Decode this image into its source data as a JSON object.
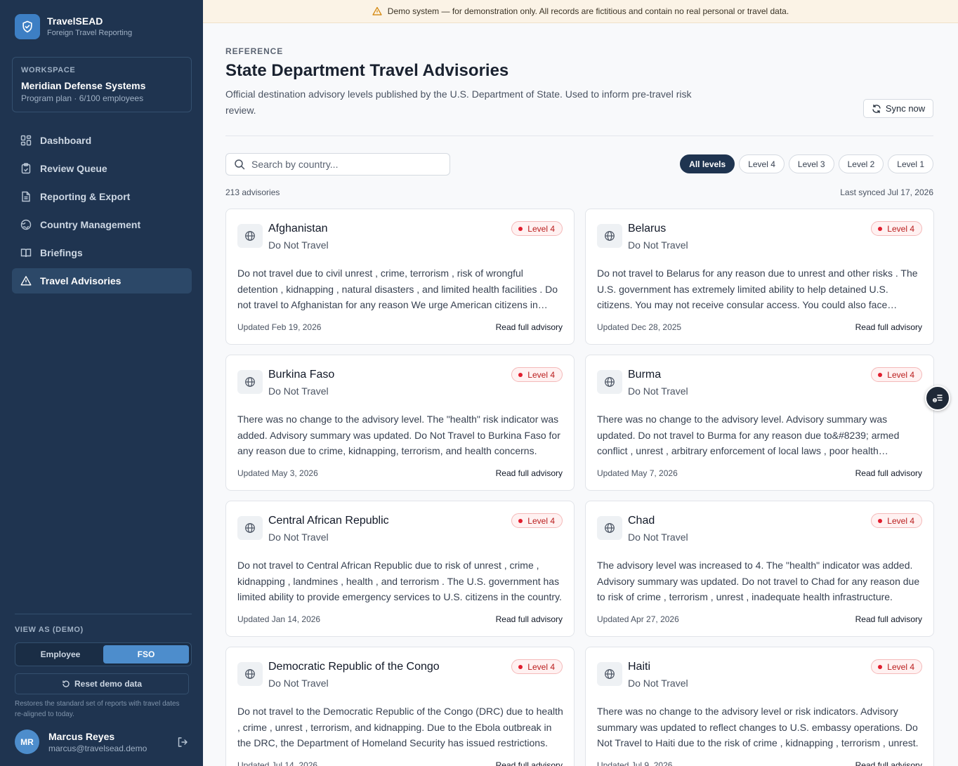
{
  "brand": {
    "name": "TravelSEAD",
    "subtitle": "Foreign Travel Reporting"
  },
  "workspace": {
    "label": "WORKSPACE",
    "name": "Meridian Defense Systems",
    "plan": "Program plan · 6/100 employees"
  },
  "nav": [
    {
      "label": "Dashboard",
      "icon": "dashboard-icon",
      "active": false
    },
    {
      "label": "Review Queue",
      "icon": "clipboard-icon",
      "active": false
    },
    {
      "label": "Reporting & Export",
      "icon": "document-icon",
      "active": false
    },
    {
      "label": "Country Management",
      "icon": "globe-icon",
      "active": false
    },
    {
      "label": "Briefings",
      "icon": "book-icon",
      "active": false
    },
    {
      "label": "Travel Advisories",
      "icon": "warning-icon",
      "active": true
    }
  ],
  "view_as": {
    "label": "VIEW AS (DEMO)",
    "options": [
      "Employee",
      "FSO"
    ],
    "selected": "FSO"
  },
  "reset": {
    "label": "Reset demo data",
    "note": "Restores the standard set of reports with travel dates re-aligned to today."
  },
  "user": {
    "initials": "MR",
    "name": "Marcus Reyes",
    "email": "marcus@travelsead.demo"
  },
  "banner": {
    "text": "Demo system — for demonstration only. All records are fictitious and contain no real personal or travel data."
  },
  "page": {
    "eyebrow": "REFERENCE",
    "title": "State Department Travel Advisories",
    "description": "Official destination advisory levels published by the U.S. Department of State. Used to inform pre-travel risk review.",
    "sync_label": "Sync now",
    "search_placeholder": "Search by country...",
    "filters": [
      "All levels",
      "Level 4",
      "Level 3",
      "Level 2",
      "Level 1"
    ],
    "active_filter": "All levels",
    "count": "213 advisories",
    "last_synced": "Last synced Jul 17, 2026"
  },
  "colors": {
    "sidebar": "#1f3450",
    "accent": "#4d8dcc",
    "level4": "#e11d2d"
  },
  "advisories": [
    {
      "country": "Afghanistan",
      "status": "Do Not Travel",
      "level": "Level 4",
      "summary": "Do not travel due to civil unrest , crime, terrorism , risk of wrongful detention , kidnapping , natural disasters , and limited health facilities . Do not travel to Afghanistan for any reason We urge American citizens in Afghanistan to leave immediately.",
      "updated": "Updated Feb 19, 2026",
      "link": "Read full advisory"
    },
    {
      "country": "Belarus",
      "status": "Do Not Travel",
      "level": "Level 4",
      "summary": "Do not travel to Belarus for any reason due to unrest and other risks . The U.S. government has extremely limited ability to help detained U.S. citizens. You may not receive consular access. You could also face arbitrary enforcement of local laws.",
      "updated": "Updated Dec 28, 2025",
      "link": "Read full advisory"
    },
    {
      "country": "Burkina Faso",
      "status": "Do Not Travel",
      "level": "Level 4",
      "summary": "There was no change to the advisory level. The \"health\" risk indicator was added. Advisory summary was updated. Do Not Travel to Burkina Faso for any reason due to crime, kidnapping, terrorism, and health concerns.",
      "updated": "Updated May 3, 2026",
      "link": "Read full advisory"
    },
    {
      "country": "Burma",
      "status": "Do Not Travel",
      "level": "Level 4",
      "summary": "There was no change to the advisory level. Advisory summary was updated. Do not travel to Burma for any reason due to&#8239; armed conflict , unrest , arbitrary enforcement of local laws , poor health infrastructure.",
      "updated": "Updated May 7, 2026",
      "link": "Read full advisory"
    },
    {
      "country": "Central African Republic",
      "status": "Do Not Travel",
      "level": "Level 4",
      "summary": "Do not travel to Central African Republic due to risk of unrest , crime , kidnapping , landmines , health , and terrorism . The U.S. government has limited ability to provide emergency services to U.S. citizens in the country.",
      "updated": "Updated Jan 14, 2026",
      "link": "Read full advisory"
    },
    {
      "country": "Chad",
      "status": "Do Not Travel",
      "level": "Level 4",
      "summary": "The advisory level was increased to 4. The \"health\" indicator was added. Advisory summary was updated. Do not travel to Chad for any reason due to risk of crime , terrorism , unrest , inadequate health infrastructure.",
      "updated": "Updated Apr 27, 2026",
      "link": "Read full advisory"
    },
    {
      "country": "Democratic Republic of the Congo",
      "status": "Do Not Travel",
      "level": "Level 4",
      "summary": "Do not travel to the Democratic Republic of the Congo (DRC) due to health , crime , unrest , terrorism, and kidnapping. Due to the Ebola outbreak in the DRC, the Department of Homeland Security has issued restrictions.",
      "updated": "Updated Jul 14, 2026",
      "link": "Read full advisory"
    },
    {
      "country": "Haiti",
      "status": "Do Not Travel",
      "level": "Level 4",
      "summary": "There was no change to the advisory level or risk indicators. Advisory summary was updated to reflect changes to U.S. embassy operations. Do Not Travel to Haiti due to the risk of crime , kidnapping , terrorism , unrest.",
      "updated": "Updated Jul 9, 2026",
      "link": "Read full advisory"
    }
  ]
}
